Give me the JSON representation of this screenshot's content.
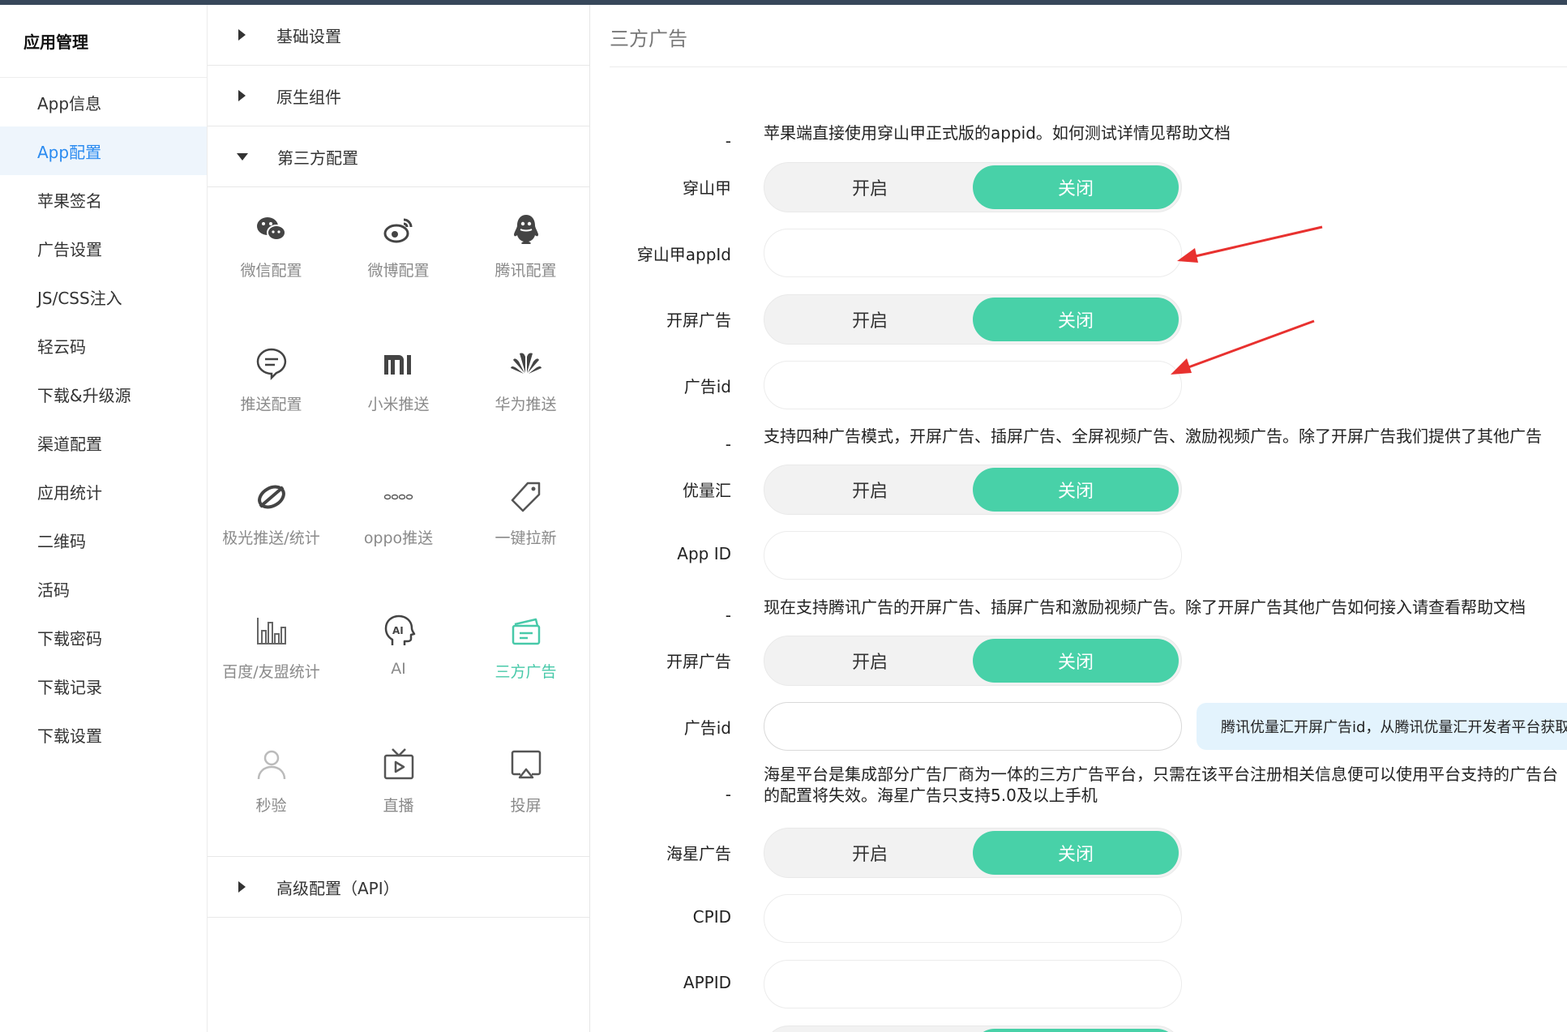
{
  "sidebar": {
    "title": "应用管理",
    "items": [
      {
        "label": "App信息"
      },
      {
        "label": "App配置"
      },
      {
        "label": "苹果签名"
      },
      {
        "label": "广告设置"
      },
      {
        "label": "JS/CSS注入"
      },
      {
        "label": "轻云码"
      },
      {
        "label": "下载&升级源"
      },
      {
        "label": "渠道配置"
      },
      {
        "label": "应用统计"
      },
      {
        "label": "二维码"
      },
      {
        "label": "活码"
      },
      {
        "label": "下载密码"
      },
      {
        "label": "下载记录"
      },
      {
        "label": "下载设置"
      }
    ],
    "active_index": 1
  },
  "middle": {
    "sections": [
      {
        "label": "基础设置"
      },
      {
        "label": "原生组件"
      },
      {
        "label": "第三方配置"
      },
      {
        "label": "高级配置（API）"
      }
    ],
    "tiles": [
      {
        "label": "微信配置",
        "icon": "wechat-icon"
      },
      {
        "label": "微博配置",
        "icon": "weibo-icon"
      },
      {
        "label": "腾讯配置",
        "icon": "qq-icon"
      },
      {
        "label": "推送配置",
        "icon": "message-icon"
      },
      {
        "label": "小米推送",
        "icon": "xiaomi-icon"
      },
      {
        "label": "华为推送",
        "icon": "huawei-icon"
      },
      {
        "label": "极光推送/统计",
        "icon": "jiguang-icon"
      },
      {
        "label": "oppo推送",
        "icon": "oppo-icon"
      },
      {
        "label": "一键拉新",
        "icon": "tag-icon"
      },
      {
        "label": "百度/友盟统计",
        "icon": "bar-chart-icon"
      },
      {
        "label": "AI",
        "icon": "ai-head-icon"
      },
      {
        "label": "三方广告",
        "icon": "ad-cards-icon"
      },
      {
        "label": "秒验",
        "icon": "user-icon"
      },
      {
        "label": "直播",
        "icon": "tv-icon"
      },
      {
        "label": "投屏",
        "icon": "cast-icon"
      }
    ],
    "active_tile_index": 11
  },
  "main": {
    "title": "三方广告",
    "dash": "-",
    "toggle_on": "开启",
    "toggle_off": "关闭",
    "notes": {
      "pangle": "苹果端直接使用穿山甲正式版的appid。如何测试详情见帮助文档",
      "ubix": "支持四种广告模式，开屏广告、插屏广告、全屏视频广告、激励视频广告。除了开屏广告我们提供了其他广告",
      "tencent": "现在支持腾讯广告的开屏广告、插屏广告和激励视频广告。除了开屏广告其他广告如何接入请查看帮助文档",
      "haixing": "海星平台是集成部分广告厂商为一体的三方广告平台，只需在该平台注册相关信息便可以使用平台支持的广告台的配置将失效。海星广告只支持5.0及以上手机"
    },
    "labels": {
      "pangle": "穿山甲",
      "pangle_appid": "穿山甲appId",
      "splash1": "开屏广告",
      "adid1": "广告id",
      "ubix": "优量汇",
      "appid": "App ID",
      "splash2": "开屏广告",
      "adid2": "广告id",
      "haixing": "海星广告",
      "cpid": "CPID",
      "appid2": "APPID"
    },
    "tip": "腾讯优量汇开屏广告id，从腾讯优量汇开发者平台获取"
  },
  "colors": {
    "accent_green": "#48d1a8",
    "active_blue": "#2b8bf0",
    "arrow_red": "#e8312f",
    "tip_bg": "#e3f3fd"
  }
}
